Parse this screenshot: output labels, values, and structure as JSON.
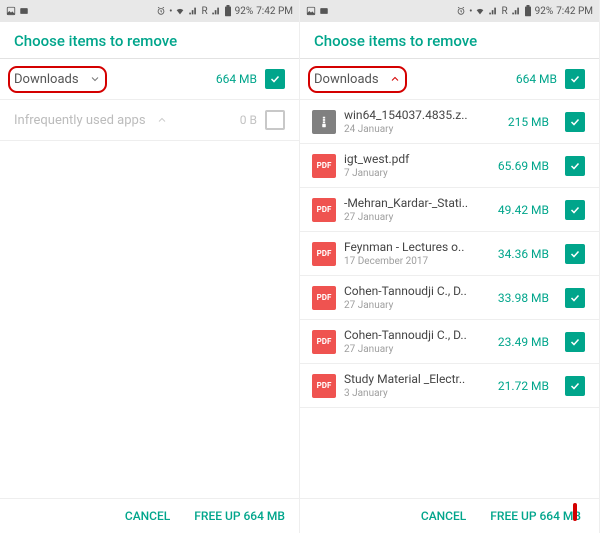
{
  "status": {
    "battery": "92%",
    "time": "7:42 PM",
    "roaming": "R"
  },
  "header": "Choose items to remove",
  "sections": {
    "downloads_label": "Downloads",
    "downloads_size": "664 MB",
    "infreq_label": "Infrequently used apps",
    "infreq_size": "0 B"
  },
  "files": [
    {
      "icon": "zip",
      "iconText": "",
      "name": "win64_154037.4835.z..",
      "date": "24 January",
      "size": "215 MB"
    },
    {
      "icon": "pdf",
      "iconText": "PDF",
      "name": "igt_west.pdf",
      "date": "7 January",
      "size": "65.69 MB"
    },
    {
      "icon": "pdf",
      "iconText": "PDF",
      "name": "-Mehran_Kardar-_Stati..",
      "date": "27 January",
      "size": "49.42 MB"
    },
    {
      "icon": "pdf",
      "iconText": "PDF",
      "name": "Feynman - Lectures o..",
      "date": "17 December 2017",
      "size": "34.36 MB"
    },
    {
      "icon": "pdf",
      "iconText": "PDF",
      "name": "Cohen-Tannoudji C., D..",
      "date": "27 January",
      "size": "33.98 MB"
    },
    {
      "icon": "pdf",
      "iconText": "PDF",
      "name": "Cohen-Tannoudji C., D..",
      "date": "27 January",
      "size": "23.49 MB"
    },
    {
      "icon": "pdf",
      "iconText": "PDF",
      "name": "Study Material _Electr..",
      "date": "3 January",
      "size": "21.72 MB"
    }
  ],
  "footer": {
    "cancel": "CANCEL",
    "freeup": "FREE UP 664 MB"
  }
}
